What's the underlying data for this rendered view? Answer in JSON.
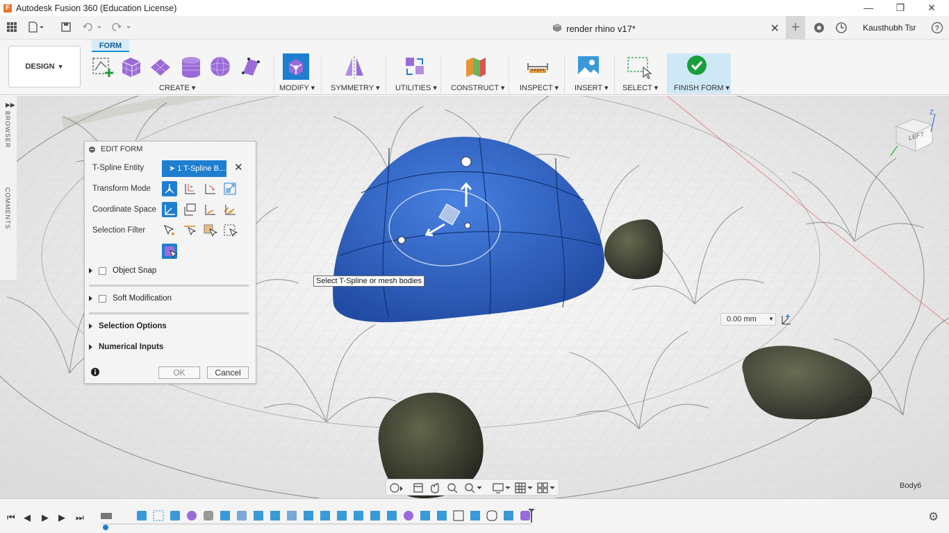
{
  "window": {
    "app_title": "Autodesk Fusion 360 (Education License)",
    "logo_letter": "F",
    "minimize": "—",
    "restore": "❐",
    "close": "✕"
  },
  "quickbar": {
    "document_title": "render rhino v17*",
    "doc_close": "✕",
    "new_tab": "+",
    "user_name": "Kausthubh Tsr",
    "help": "?"
  },
  "toolbar": {
    "workspace": "DESIGN",
    "active_tab": "FORM",
    "groups": [
      {
        "label": "CREATE"
      },
      {
        "label": "MODIFY"
      },
      {
        "label": "SYMMETRY"
      },
      {
        "label": "UTILITIES"
      },
      {
        "label": "CONSTRUCT"
      },
      {
        "label": "INSPECT"
      },
      {
        "label": "INSERT"
      },
      {
        "label": "SELECT"
      },
      {
        "label": "FINISH FORM"
      }
    ],
    "accent_color": "#0696d7"
  },
  "side": {
    "browser": "BROWSER",
    "comments": "COMMENTS"
  },
  "edit_form": {
    "title": "EDIT FORM",
    "tspline_label": "T-Spline Entity",
    "tspline_value": "1 T-Spline B...",
    "transform_label": "Transform Mode",
    "coord_label": "Coordinate Space",
    "filter_label": "Selection Filter",
    "object_snap": "Object Snap",
    "soft_mod": "Soft Modification",
    "sel_options": "Selection Options",
    "num_inputs": "Numerical Inputs",
    "ok": "OK",
    "cancel": "Cancel",
    "active_color": "#1e7fd0"
  },
  "viewport": {
    "tooltip": "Select T-Spline or mesh bodies",
    "distance_value": "0.00 mm",
    "view_cube_face": "LEFT",
    "body_label": "Body6",
    "body_color": "#1a55c4"
  }
}
